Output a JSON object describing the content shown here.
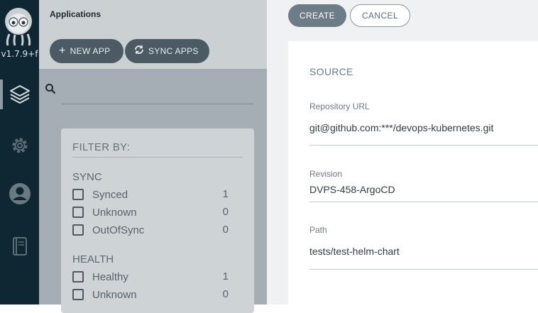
{
  "nav": {
    "version": "v1.7.9+f",
    "items": [
      {
        "icon": "layers-icon",
        "active": true
      },
      {
        "icon": "gear-icon",
        "active": false
      },
      {
        "icon": "user-icon",
        "active": false
      },
      {
        "icon": "book-icon",
        "active": false
      }
    ]
  },
  "apps": {
    "title": "Applications",
    "new_app_label": "NEW APP",
    "sync_apps_label": "SYNC APPS",
    "search": {
      "value": "",
      "placeholder": ""
    }
  },
  "filter": {
    "heading": "FILTER BY:",
    "sections": [
      {
        "title": "SYNC",
        "rows": [
          {
            "label": "Synced",
            "count": "1"
          },
          {
            "label": "Unknown",
            "count": "0"
          },
          {
            "label": "OutOfSync",
            "count": "0"
          }
        ]
      },
      {
        "title": "HEALTH",
        "rows": [
          {
            "label": "Healthy",
            "count": "1"
          },
          {
            "label": "Unknown",
            "count": "0"
          }
        ]
      }
    ]
  },
  "form": {
    "create_label": "CREATE",
    "cancel_label": "CANCEL",
    "source": {
      "heading": "SOURCE",
      "repo_url_label": "Repository URL",
      "repo_url_value": "git@github.com:***/devops-kubernetes.git",
      "revision_label": "Revision",
      "revision_value": "DVPS-458-ArgoCD",
      "path_label": "Path",
      "path_value": "tests/test-helm-chart"
    }
  },
  "colors": {
    "nav_bg": "#0f2733",
    "pill_bg": "#4b5a63",
    "create_bg": "#6c7d87"
  }
}
